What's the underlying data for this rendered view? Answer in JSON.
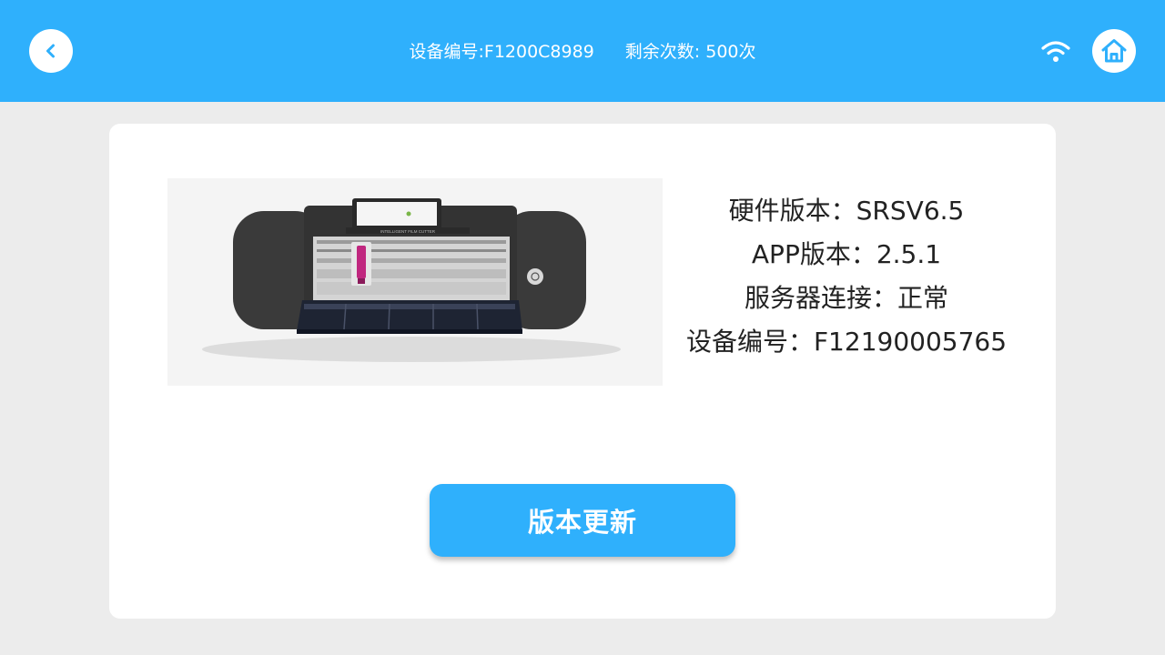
{
  "header": {
    "device_id_text": "设备编号:F1200C8989",
    "remaining_text": "剩余次数: 500次",
    "back_icon": "chevron-left-icon",
    "wifi_icon": "wifi-icon",
    "home_icon": "home-icon"
  },
  "device_info": {
    "hardware_version": "硬件版本：SRSV6.5",
    "app_version": "APP版本：2.5.1",
    "server_connection": "服务器连接：正常",
    "device_number": "设备编号：F12190005765"
  },
  "product_image": {
    "printed_label": "INTELLIGENT FILM CUTTER"
  },
  "actions": {
    "update_label": "版本更新"
  },
  "colors": {
    "accent": "#2fb0fc",
    "background": "#ececec",
    "card": "#ffffff"
  }
}
